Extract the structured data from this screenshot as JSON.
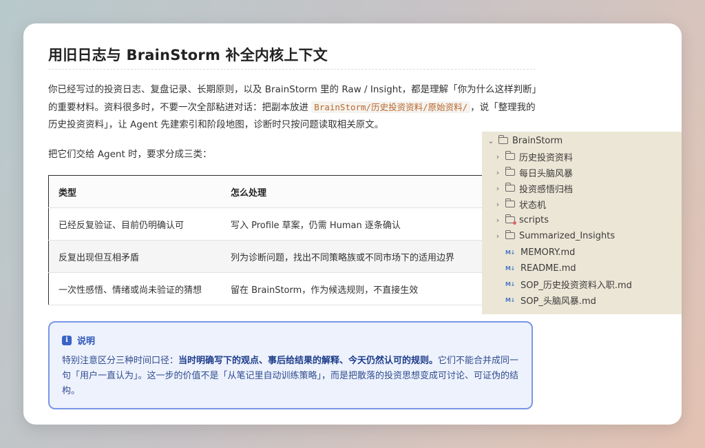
{
  "heading": "用旧日志与 BrainStorm 补全内核上下文",
  "intro": {
    "before_code": "你已经写过的投资日志、复盘记录、长期原则，以及 BrainStorm 里的 Raw / Insight，都是理解「你为什么这样判断」的重要材料。资料很多时，不要一次全部粘进对话：把副本放进 ",
    "code_path": "BrainStorm/历史投资资料/原始资料/",
    "after_code": "，说「整理我的历史投资资料」，让 Agent 先建索引和阶段地图，诊断时只按问题读取相关原文。"
  },
  "lead": "把它们交给 Agent 时，要求分成三类：",
  "table": {
    "headers": [
      "类型",
      "怎么处理"
    ],
    "rows": [
      [
        "已经反复验证、目前仍明确认可",
        "写入 Profile 草案，仍需 Human 逐条确认"
      ],
      [
        "反复出现但互相矛盾",
        "列为诊断问题，找出不同策略族或不同市场下的适用边界"
      ],
      [
        "一次性感悟、情绪或尚未验证的猜想",
        "留在 BrainStorm，作为候选规则，不直接生效"
      ]
    ]
  },
  "note": {
    "title": "说明",
    "lead": "特别注意区分三种时间口径：",
    "bold": "当时明确写下的观点、事后给结果的解释、今天仍然认可的规则。",
    "rest": "它们不能合并成同一句「用户一直认为」。这一步的价值不是「从笔记里自动训练策略」，而是把散落的投资思想变成可讨论、可证伪的结构。"
  },
  "explorer": {
    "root": "BrainStorm",
    "folders": [
      "历史投资资料",
      "每日头脑风暴",
      "投资感悟归档",
      "状态机",
      "scripts",
      "Summarized_Insights"
    ],
    "files": [
      "MEMORY.md",
      "README.md",
      "SOP_历史投资资料入职.md",
      "SOP_头脑风暴.md"
    ],
    "md_badge": "M↓"
  }
}
